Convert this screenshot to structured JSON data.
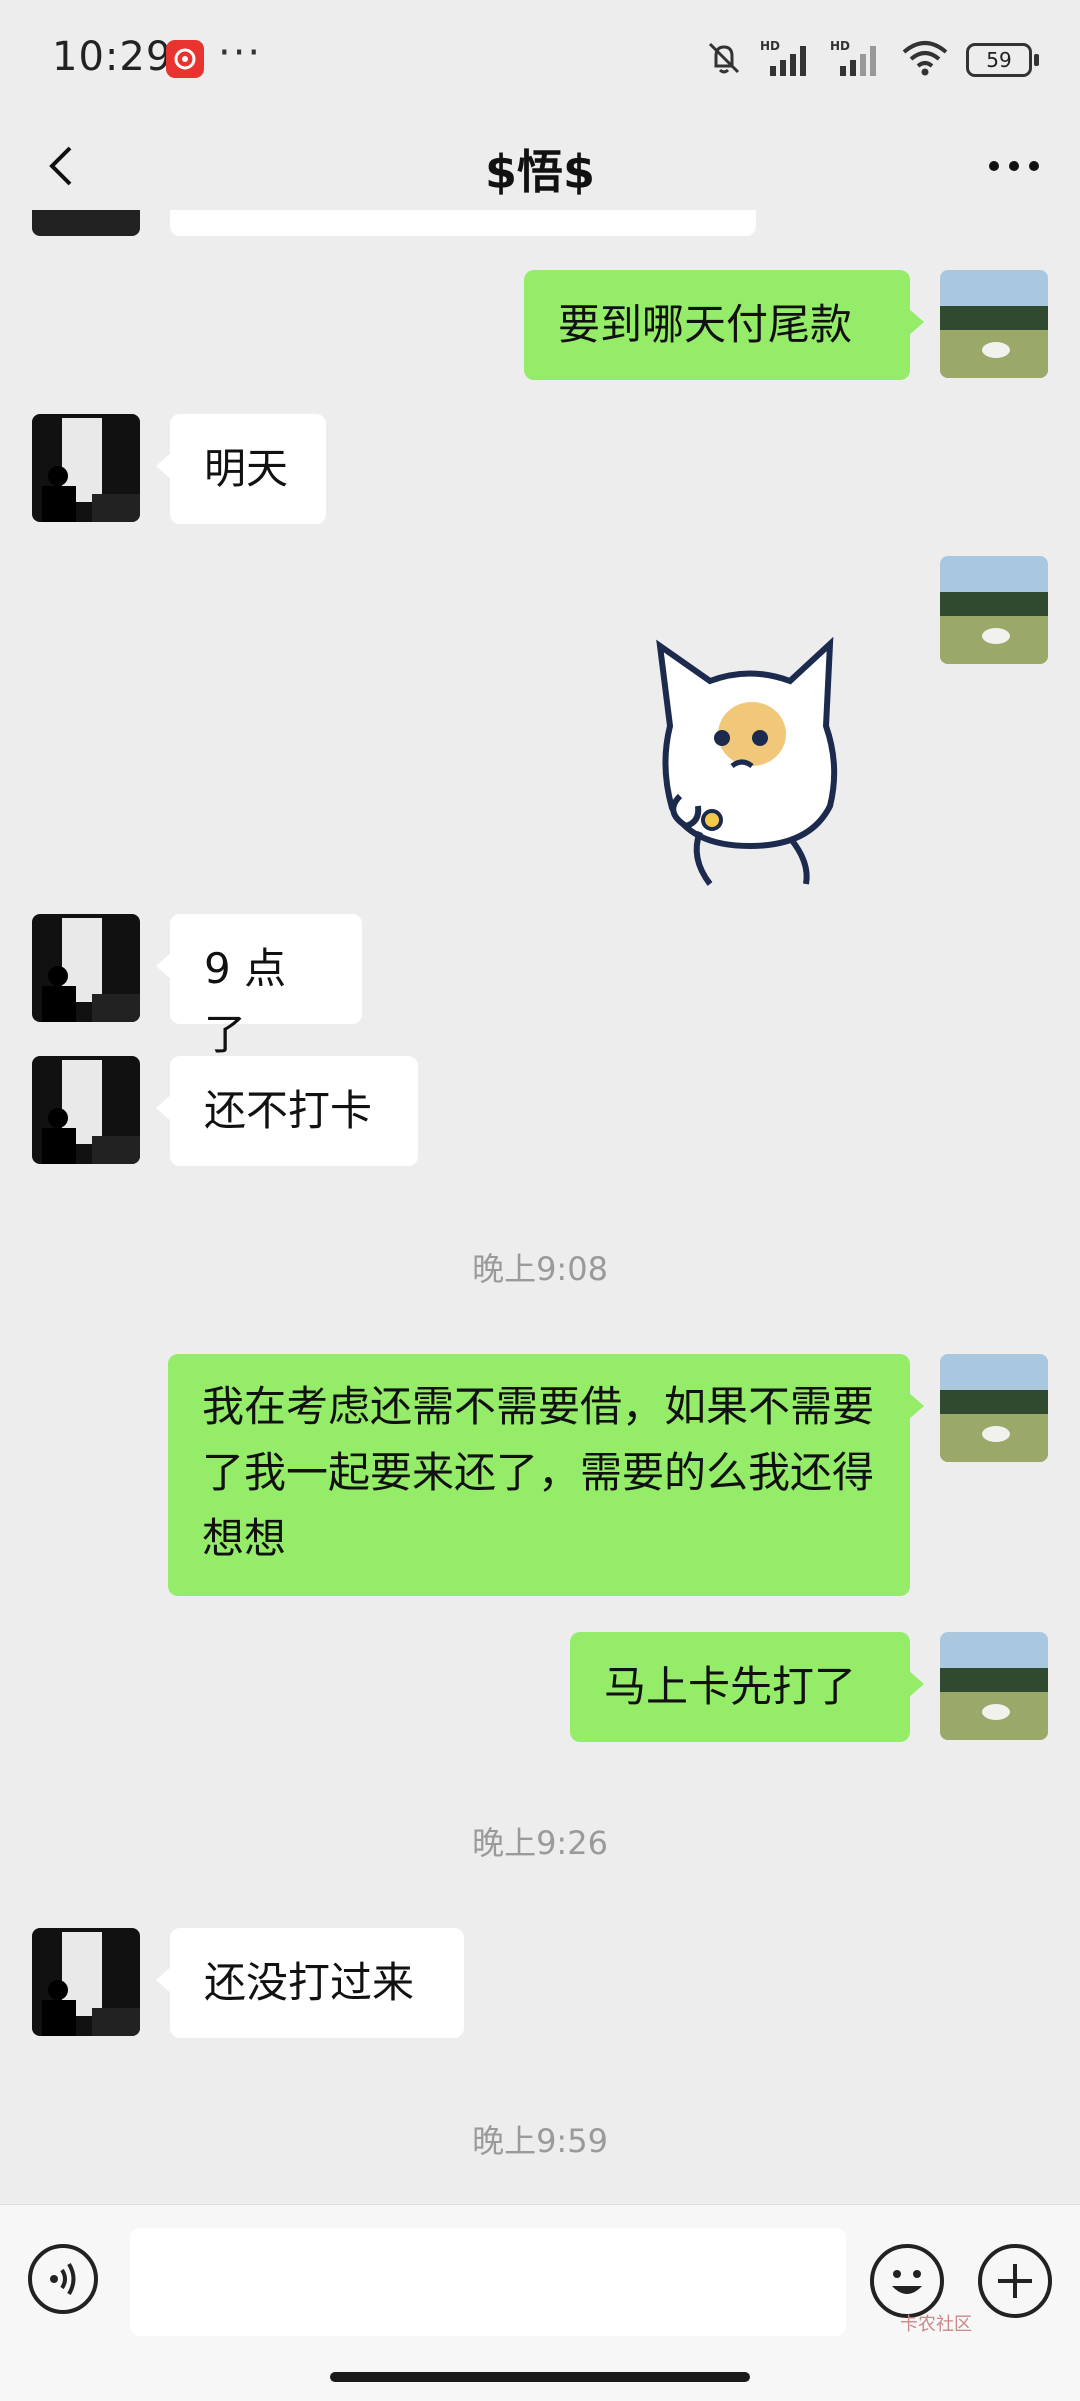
{
  "status_bar": {
    "time": "10:29",
    "dots": "···",
    "battery": "59",
    "signal_label": "HD"
  },
  "header": {
    "title": "$悟$"
  },
  "messages": {
    "m1": "要到哪天付尾款",
    "m2": "明天",
    "m3": "9 点了",
    "m4": "还不打卡",
    "t1": "晚上9:08",
    "m5": "我在考虑还需不需要借，如果不需要了我一起要来还了，需要的么我还得想想",
    "m6": "马上卡先打了",
    "t2": "晚上9:26",
    "m7": "还没打过来",
    "t3": "晚上9:59"
  },
  "watermark": "卡农社区",
  "colors": {
    "background": "#ededed",
    "sent_bubble": "#95ec69",
    "received_bubble": "#ffffff",
    "timestamp": "#9a9a9a"
  }
}
